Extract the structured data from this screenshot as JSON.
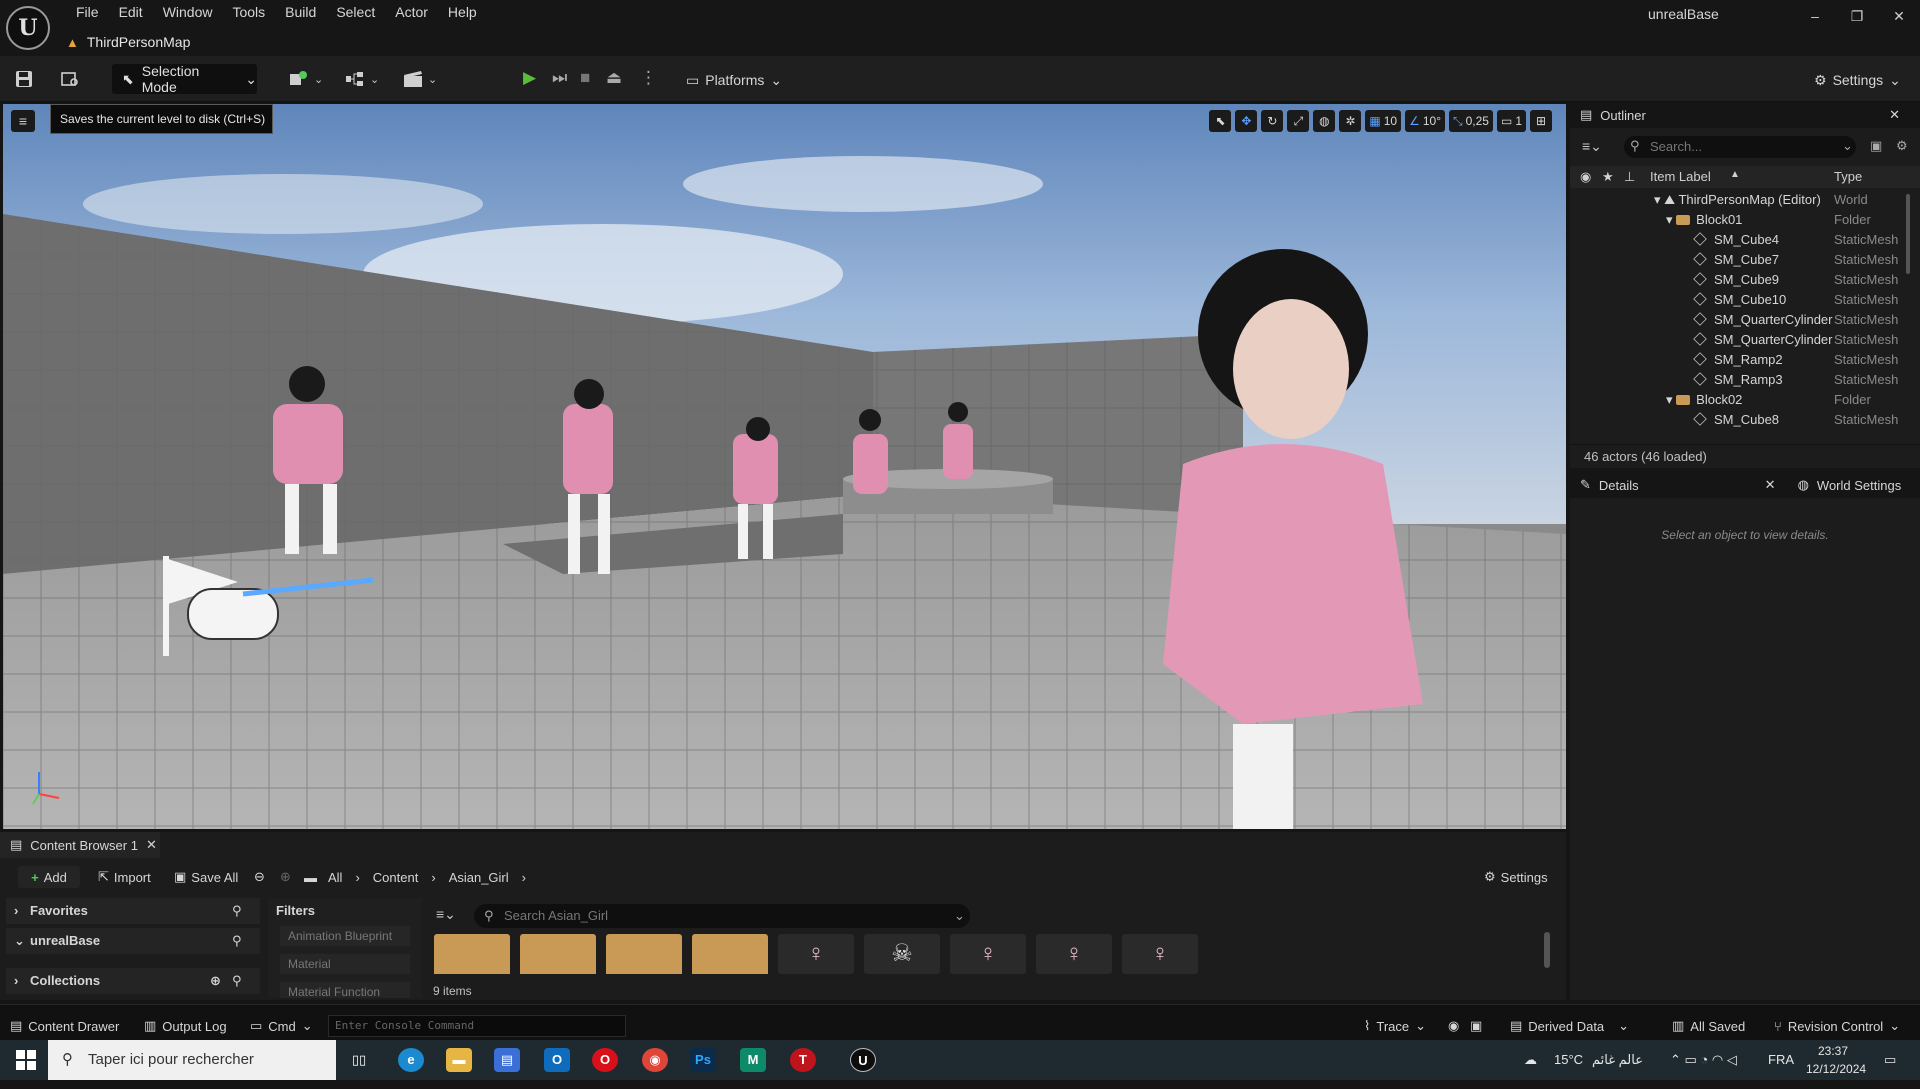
{
  "app": {
    "title": "unrealBase",
    "map_tab": "ThirdPersonMap"
  },
  "menu": [
    "File",
    "Edit",
    "Window",
    "Tools",
    "Build",
    "Select",
    "Actor",
    "Help"
  ],
  "window_controls": {
    "minimize": "–",
    "maximize": "❐",
    "close": "✕"
  },
  "toolbar": {
    "selection_mode": "Selection Mode",
    "platforms": "Platforms",
    "settings": "Settings"
  },
  "tooltip": "Saves the current level to disk (Ctrl+S)",
  "viewport": {
    "grid": "10",
    "rotation": "10°",
    "scale": "0,25",
    "camera_speed": "1"
  },
  "outliner": {
    "title": "Outliner",
    "search_placeholder": "Search...",
    "col_label": "Item Label",
    "col_type": "Type",
    "rows": [
      {
        "label": "ThirdPersonMap (Editor)",
        "type": "World",
        "kind": "world"
      },
      {
        "label": "Block01",
        "type": "Folder",
        "kind": "folder"
      },
      {
        "label": "SM_Cube4",
        "type": "StaticMesh",
        "kind": "mesh"
      },
      {
        "label": "SM_Cube7",
        "type": "StaticMesh",
        "kind": "mesh"
      },
      {
        "label": "SM_Cube9",
        "type": "StaticMesh",
        "kind": "mesh"
      },
      {
        "label": "SM_Cube10",
        "type": "StaticMesh",
        "kind": "mesh"
      },
      {
        "label": "SM_QuarterCylinder",
        "type": "StaticMesh",
        "kind": "mesh"
      },
      {
        "label": "SM_QuarterCylinder",
        "type": "StaticMesh",
        "kind": "mesh"
      },
      {
        "label": "SM_Ramp2",
        "type": "StaticMesh",
        "kind": "mesh"
      },
      {
        "label": "SM_Ramp3",
        "type": "StaticMesh",
        "kind": "mesh"
      },
      {
        "label": "Block02",
        "type": "Folder",
        "kind": "folder"
      },
      {
        "label": "SM_Cube8",
        "type": "StaticMesh",
        "kind": "mesh"
      }
    ],
    "footer": "46 actors (46 loaded)"
  },
  "details": {
    "tab": "Details",
    "world_settings_tab": "World Settings",
    "empty": "Select an object to view details."
  },
  "content_browser": {
    "tab": "Content Browser 1",
    "add": "Add",
    "import": "Import",
    "save_all": "Save All",
    "path": [
      "All",
      "Content",
      "Asian_Girl"
    ],
    "settings": "Settings",
    "favorites": "Favorites",
    "project": "unrealBase",
    "collections": "Collections",
    "filters_title": "Filters",
    "filters": [
      "Animation Blueprint",
      "Material",
      "Material Function"
    ],
    "search_placeholder": "Search Asian_Girl",
    "items": [
      "folder",
      "folder",
      "folder",
      "folder",
      "mesh",
      "skeleton",
      "mesh",
      "mesh",
      "mesh"
    ],
    "item_count": "9 items"
  },
  "statusbar": {
    "content_drawer": "Content Drawer",
    "output_log": "Output Log",
    "cmd": "Cmd",
    "console_placeholder": "Enter Console Command",
    "trace": "Trace",
    "derived_data": "Derived Data",
    "all_saved": "All Saved",
    "revision_control": "Revision Control"
  },
  "taskbar": {
    "search": "Taper ici pour rechercher",
    "weather": "15°C",
    "weather_text": "عالم غائم",
    "lang": "FRA",
    "time": "23:37",
    "date": "12/12/2024"
  }
}
